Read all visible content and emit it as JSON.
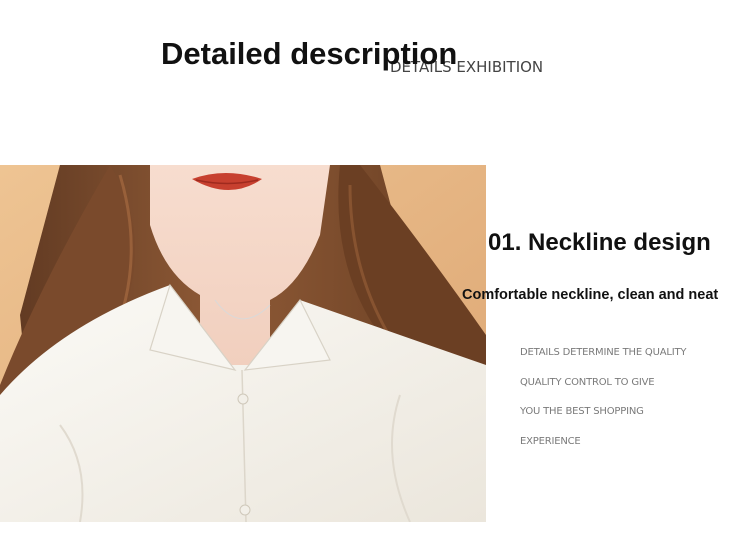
{
  "header": {
    "title": "Detailed description",
    "subtitle": "DETAILS EXHIBITION"
  },
  "photo": {
    "subject": "model-wearing-white-shirt"
  },
  "feature": {
    "title": "01. Neckline design",
    "subtitle": "Comfortable neckline, clean and neat",
    "detail_lines": [
      "DETAILS DETERMINE THE QUALITY",
      "QUALITY CONTROL TO GIVE",
      "YOU THE BEST SHOPPING",
      "EXPERIENCE"
    ]
  },
  "colors": {
    "background": "#ffffff",
    "photo_backdrop": "#e7b985",
    "shirt": "#f5f2ec",
    "hair": "#7a4a2c",
    "lips": "#c7402f",
    "title_text": "#111111",
    "detail_text": "#7a7a7a"
  }
}
